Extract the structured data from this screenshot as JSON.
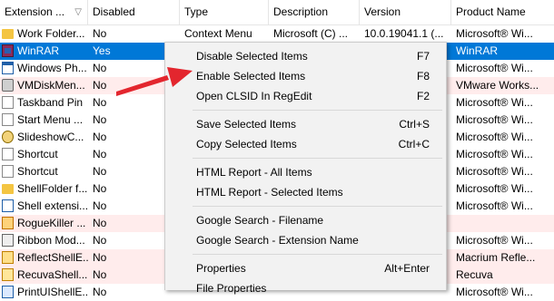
{
  "columns": [
    {
      "label": "Extension ...",
      "sort_icon": "sort-descending-icon"
    },
    {
      "label": "Disabled"
    },
    {
      "label": "Type"
    },
    {
      "label": "Description"
    },
    {
      "label": "Version"
    },
    {
      "label": "Product Name"
    }
  ],
  "rows": [
    {
      "name": "Work Folder...",
      "disabled": "No",
      "type": "Context Menu",
      "description": "Microsoft (C) ...",
      "version": "10.0.19041.1 (...",
      "product": "Microsoft® Wi...",
      "icon": "folder-gear-icon",
      "state": "normal"
    },
    {
      "name": "WinRAR",
      "disabled": "Yes",
      "type": "",
      "description": "",
      "version": "",
      "product": "WinRAR",
      "icon": "winrar-icon",
      "state": "selected"
    },
    {
      "name": "Windows Ph...",
      "disabled": "No",
      "type": "",
      "description": "",
      "version": "",
      "product": "Microsoft® Wi...",
      "icon": "window-icon",
      "state": "normal"
    },
    {
      "name": "VMDiskMen...",
      "disabled": "No",
      "type": "",
      "description": "",
      "version": "",
      "product": "VMware Works...",
      "icon": "disk-icon",
      "state": "disabled"
    },
    {
      "name": "Taskband Pin",
      "disabled": "No",
      "type": "",
      "description": "",
      "version": "",
      "product": "Microsoft® Wi...",
      "icon": "document-icon",
      "state": "normal"
    },
    {
      "name": "Start Menu ...",
      "disabled": "No",
      "type": "",
      "description": "",
      "version": "",
      "product": "Microsoft® Wi...",
      "icon": "document-icon",
      "state": "normal"
    },
    {
      "name": "SlideshowC...",
      "disabled": "No",
      "type": "",
      "description": "",
      "version": "",
      "product": "Microsoft® Wi...",
      "icon": "gear-icon",
      "state": "normal"
    },
    {
      "name": "Shortcut",
      "disabled": "No",
      "type": "",
      "description": "",
      "version": "",
      "product": "Microsoft® Wi...",
      "icon": "document-icon",
      "state": "normal"
    },
    {
      "name": "Shortcut",
      "disabled": "No",
      "type": "",
      "description": "",
      "version": "",
      "product": "Microsoft® Wi...",
      "icon": "document-icon",
      "state": "normal"
    },
    {
      "name": "ShellFolder f...",
      "disabled": "No",
      "type": "",
      "description": "",
      "version": "",
      "product": "Microsoft® Wi...",
      "icon": "folder-icon",
      "state": "normal"
    },
    {
      "name": "Shell extensi...",
      "disabled": "No",
      "type": "",
      "description": "",
      "version": "",
      "product": "Microsoft® Wi...",
      "icon": "shell-icon",
      "state": "normal"
    },
    {
      "name": "RogueKiller ...",
      "disabled": "No",
      "type": "",
      "description": "",
      "version": "",
      "product": "",
      "icon": "roguekiller-icon",
      "state": "disabled"
    },
    {
      "name": "Ribbon Mod...",
      "disabled": "No",
      "type": "",
      "description": "",
      "version": "",
      "product": "Microsoft® Wi...",
      "icon": "ribbon-icon",
      "state": "normal"
    },
    {
      "name": "ReflectShellE...",
      "disabled": "No",
      "type": "",
      "description": "",
      "version": "",
      "product": "Macrium Refle...",
      "icon": "reflect-icon",
      "state": "disabled"
    },
    {
      "name": "RecuvaShell...",
      "disabled": "No",
      "type": "",
      "description": "",
      "version": "",
      "product": "Recuva",
      "icon": "recuva-icon",
      "state": "disabled"
    },
    {
      "name": "PrintUIShellE...",
      "disabled": "No",
      "type": "",
      "description": "",
      "version": "",
      "product": "Microsoft® Wi...",
      "icon": "printui-icon",
      "state": "normal"
    }
  ],
  "context_menu": {
    "groups": [
      [
        {
          "label": "Disable Selected Items",
          "shortcut": "F7"
        },
        {
          "label": "Enable Selected Items",
          "shortcut": "F8"
        },
        {
          "label": "Open CLSID In RegEdit",
          "shortcut": "F2"
        }
      ],
      [
        {
          "label": "Save Selected Items",
          "shortcut": "Ctrl+S"
        },
        {
          "label": "Copy Selected Items",
          "shortcut": "Ctrl+C"
        }
      ],
      [
        {
          "label": "HTML Report - All Items",
          "shortcut": ""
        },
        {
          "label": "HTML Report - Selected Items",
          "shortcut": ""
        }
      ],
      [
        {
          "label": "Google Search - Filename",
          "shortcut": ""
        },
        {
          "label": "Google Search - Extension Name",
          "shortcut": ""
        }
      ],
      [
        {
          "label": "Properties",
          "shortcut": "Alt+Enter"
        },
        {
          "label": "File Properties",
          "shortcut": ""
        }
      ]
    ]
  },
  "annotation": {
    "icon": "red-arrow-icon",
    "color": "#e3262e"
  },
  "colors": {
    "selected_row": "#0078d7",
    "disabled_row": "#ffecec",
    "menu_bg": "#f2f2f2"
  }
}
